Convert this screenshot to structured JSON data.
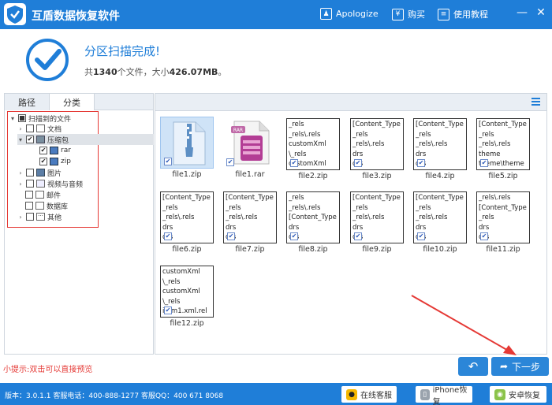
{
  "app": {
    "title": "互盾数据恢复软件"
  },
  "titlebar": {
    "apologize": "Apologize",
    "buy": "购买",
    "tutorial": "使用教程"
  },
  "header": {
    "title": "分区扫描完成!",
    "summary_prefix": "共",
    "file_count": "1340",
    "summary_mid": "个文件，大小",
    "total_size": "426.07MB",
    "summary_suffix": "。"
  },
  "left_tabs": {
    "path": "路径",
    "category": "分类"
  },
  "tree": {
    "root": "扫描到的文件",
    "items": {
      "docs": "文档",
      "archive": "压缩包",
      "rar": "rar",
      "zip": "zip",
      "images": "图片",
      "video": "视频与音频",
      "mail": "邮件",
      "database": "数据库",
      "other": "其他"
    }
  },
  "files": [
    {
      "name": "file1.zip",
      "lines": []
    },
    {
      "name": "file1.rar",
      "lines": []
    },
    {
      "name": "file2.zip",
      "lines": [
        "_rels",
        "_rels\\.rels",
        "customXml",
        "\\_rels",
        "customXml"
      ]
    },
    {
      "name": "file3.zip",
      "lines": [
        "[Content_Type",
        "_rels",
        "_rels\\.rels",
        "drs",
        "drs"
      ]
    },
    {
      "name": "file4.zip",
      "lines": [
        "[Content_Type",
        "_rels",
        "_rels\\.rels",
        "drs",
        "drs"
      ]
    },
    {
      "name": "file5.zip",
      "lines": [
        "[Content_Type",
        "_rels",
        "_rels\\.rels",
        "theme",
        "theme\\theme"
      ]
    },
    {
      "name": "file6.zip",
      "lines": [
        "[Content_Type",
        "_rels",
        "_rels\\.rels",
        "drs",
        "drs"
      ]
    },
    {
      "name": "file7.zip",
      "lines": [
        "[Content_Type",
        "_rels",
        "_rels\\.rels",
        "drs",
        "drs"
      ]
    },
    {
      "name": "file8.zip",
      "lines": [
        "_rels",
        "_rels\\.rels",
        "[Content_Type",
        "drs",
        "drs"
      ]
    },
    {
      "name": "file9.zip",
      "lines": [
        "[Content_Type",
        "_rels",
        "_rels\\.rels",
        "drs",
        "drs"
      ]
    },
    {
      "name": "file10.zip",
      "lines": [
        "[Content_Type",
        "_rels",
        "_rels\\.rels",
        "drs",
        "drs"
      ]
    },
    {
      "name": "file11.zip",
      "lines": [
        "_rels\\.rels",
        "[Content_Type",
        "_rels",
        "drs",
        "drs"
      ]
    },
    {
      "name": "file12.zip",
      "lines": [
        "customXml",
        "\\_rels",
        "customXml",
        "\\_rels",
        "item1.xml.rel"
      ]
    }
  ],
  "tip": "小提示:双击可以直接预览",
  "buttons": {
    "next": "下一步"
  },
  "footer": {
    "info": "版本：3.0.1.1  客服电话：400-888-1277    客服QQ：400 671 8068",
    "online": "在线客服",
    "iphone": "iPhone恢复",
    "android": "安卓恢复"
  },
  "colors": {
    "brand": "#1f7ed8",
    "tip": "#e53935"
  }
}
